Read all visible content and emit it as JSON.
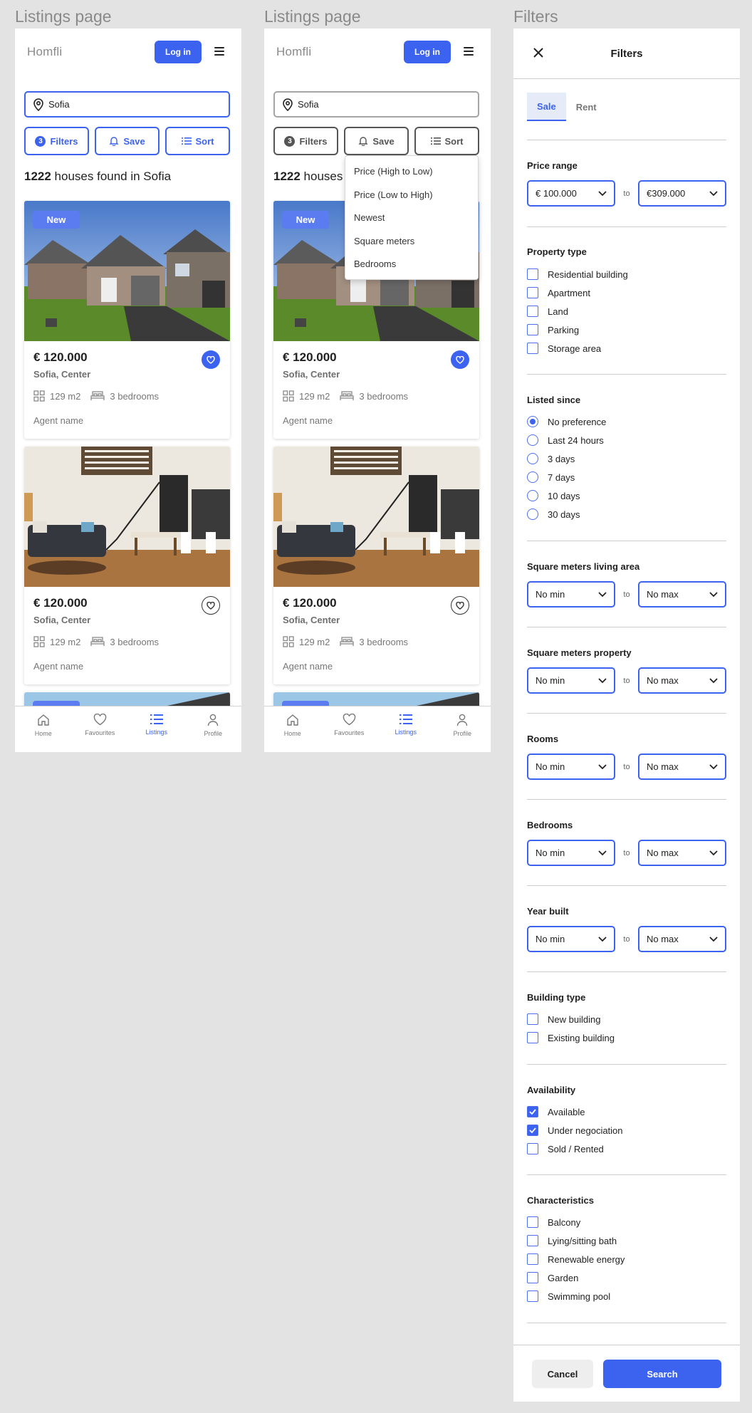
{
  "frames": {
    "listings_title": "Listings page",
    "listings_title_2": "Listings page",
    "filters_title": "Filters"
  },
  "colors": {
    "accent": "#3c63f0",
    "new_tag": "#5b7cf0"
  },
  "listing": {
    "brand": "Homfli",
    "login_label": "Log in",
    "search_value": "Sofia",
    "filters_count": "3",
    "filters_label": "Filters",
    "save_label": "Save",
    "sort_label": "Sort",
    "found_count": "1222",
    "found_text": " houses found in Sofia",
    "cards": [
      {
        "tag": "New",
        "price": "€ 120.000",
        "location": "Sofia, Center",
        "area": "129 m2",
        "bedrooms": "3 bedrooms",
        "agent": "Agent name",
        "favourite": true
      },
      {
        "tag": "",
        "price": "€ 120.000",
        "location": "Sofia, Center",
        "area": "129 m2",
        "bedrooms": "3 bedrooms",
        "agent": "Agent name",
        "favourite": false
      }
    ],
    "tabs": [
      "Home",
      "Favourites",
      "Listings",
      "Profile"
    ]
  },
  "sort_menu": [
    "Price (High to Low)",
    "Price (Low to High)",
    "Newest",
    "Square meters",
    "Bedrooms"
  ],
  "filters": {
    "title": "Filters",
    "tabs": [
      "Sale",
      "Rent"
    ],
    "to_label": "to",
    "price_range": {
      "label": "Price range",
      "min": "€ 100.000",
      "max": "€309.000"
    },
    "property_type": {
      "label": "Property type",
      "options": [
        "Residential building",
        "Apartment",
        "Land",
        "Parking",
        "Storage area"
      ]
    },
    "listed_since": {
      "label": "Listed since",
      "options": [
        "No preference",
        "Last 24 hours",
        "3 days",
        "7 days",
        "10 days",
        "30 days"
      ],
      "selected": "No preference"
    },
    "ranges": [
      {
        "label": "Square meters living area",
        "min": "No min",
        "max": "No max"
      },
      {
        "label": "Square meters property",
        "min": "No min",
        "max": "No max"
      },
      {
        "label": "Rooms",
        "min": "No min",
        "max": "No max"
      },
      {
        "label": "Bedrooms",
        "min": "No min",
        "max": "No max"
      },
      {
        "label": "Year built",
        "min": "No min",
        "max": "No max"
      }
    ],
    "building_type": {
      "label": "Building type",
      "options": [
        "New building",
        "Existing building"
      ]
    },
    "availability": {
      "label": "Availability",
      "options": [
        "Available",
        "Under negociation",
        "Sold / Rented"
      ],
      "checked": [
        "Available",
        "Under negociation"
      ]
    },
    "characteristics": {
      "label": "Characteristics",
      "options": [
        "Balcony",
        "Lying/sitting bath",
        "Renewable energy",
        "Garden",
        "Swimming pool"
      ]
    },
    "cancel_label": "Cancel",
    "search_label": "Search"
  }
}
